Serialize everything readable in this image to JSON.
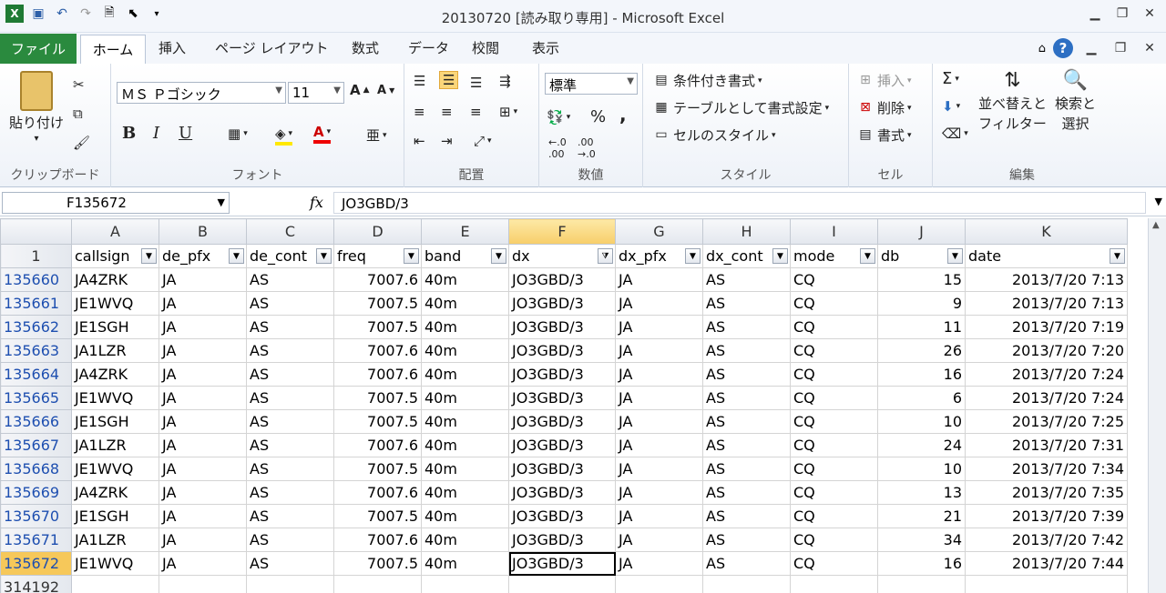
{
  "window": {
    "title": "20130720  [読み取り専用]  -  Microsoft Excel"
  },
  "tabs": [
    "ファイル",
    "ホーム",
    "挿入",
    "ページ レイアウト",
    "数式",
    "データ",
    "校閲",
    "表示"
  ],
  "ribbon": {
    "clipboard": {
      "paste": "貼り付け",
      "label": "クリップボード"
    },
    "font": {
      "name": "ＭＳ Ｐゴシック",
      "size": "11",
      "bold": "B",
      "italic": "I",
      "underline": "U",
      "label": "フォント"
    },
    "alignment": {
      "label": "配置"
    },
    "number": {
      "format": "標準",
      "percent": "%",
      "comma": ",",
      "label": "数値"
    },
    "styles": {
      "conditional": "条件付き書式",
      "table": "テーブルとして書式設定",
      "cell_styles": "セルのスタイル",
      "label": "スタイル"
    },
    "cells": {
      "insert": "挿入",
      "delete": "削除",
      "format": "書式",
      "label": "セル"
    },
    "editing": {
      "sigma": "Σ",
      "sort_filter": "並べ替えと\nフィルター",
      "find_select": "検索と\n選択",
      "label": "編集"
    }
  },
  "formula_bar": {
    "name_box": "F135672",
    "fx": "fx",
    "value": "JO3GBD/3"
  },
  "sheet": {
    "columns": [
      "A",
      "B",
      "C",
      "D",
      "E",
      "F",
      "G",
      "H",
      "I",
      "J",
      "K"
    ],
    "header_row_number": "1",
    "headers": [
      "callsign",
      "de_pfx",
      "de_cont",
      "freq",
      "band",
      "dx",
      "dx_pfx",
      "dx_cont",
      "mode",
      "db",
      "date"
    ],
    "rows": [
      {
        "n": "135660",
        "cells": [
          "JA4ZRK",
          "JA",
          "AS",
          "7007.6",
          "40m",
          "JO3GBD/3",
          "JA",
          "AS",
          "CQ",
          "15",
          "2013/7/20 7:13"
        ]
      },
      {
        "n": "135661",
        "cells": [
          "JE1WVQ",
          "JA",
          "AS",
          "7007.5",
          "40m",
          "JO3GBD/3",
          "JA",
          "AS",
          "CQ",
          "9",
          "2013/7/20 7:13"
        ]
      },
      {
        "n": "135662",
        "cells": [
          "JE1SGH",
          "JA",
          "AS",
          "7007.5",
          "40m",
          "JO3GBD/3",
          "JA",
          "AS",
          "CQ",
          "11",
          "2013/7/20 7:19"
        ]
      },
      {
        "n": "135663",
        "cells": [
          "JA1LZR",
          "JA",
          "AS",
          "7007.6",
          "40m",
          "JO3GBD/3",
          "JA",
          "AS",
          "CQ",
          "26",
          "2013/7/20 7:20"
        ]
      },
      {
        "n": "135664",
        "cells": [
          "JA4ZRK",
          "JA",
          "AS",
          "7007.6",
          "40m",
          "JO3GBD/3",
          "JA",
          "AS",
          "CQ",
          "16",
          "2013/7/20 7:24"
        ]
      },
      {
        "n": "135665",
        "cells": [
          "JE1WVQ",
          "JA",
          "AS",
          "7007.5",
          "40m",
          "JO3GBD/3",
          "JA",
          "AS",
          "CQ",
          "6",
          "2013/7/20 7:24"
        ]
      },
      {
        "n": "135666",
        "cells": [
          "JE1SGH",
          "JA",
          "AS",
          "7007.5",
          "40m",
          "JO3GBD/3",
          "JA",
          "AS",
          "CQ",
          "10",
          "2013/7/20 7:25"
        ]
      },
      {
        "n": "135667",
        "cells": [
          "JA1LZR",
          "JA",
          "AS",
          "7007.6",
          "40m",
          "JO3GBD/3",
          "JA",
          "AS",
          "CQ",
          "24",
          "2013/7/20 7:31"
        ]
      },
      {
        "n": "135668",
        "cells": [
          "JE1WVQ",
          "JA",
          "AS",
          "7007.5",
          "40m",
          "JO3GBD/3",
          "JA",
          "AS",
          "CQ",
          "10",
          "2013/7/20 7:34"
        ]
      },
      {
        "n": "135669",
        "cells": [
          "JA4ZRK",
          "JA",
          "AS",
          "7007.6",
          "40m",
          "JO3GBD/3",
          "JA",
          "AS",
          "CQ",
          "13",
          "2013/7/20 7:35"
        ]
      },
      {
        "n": "135670",
        "cells": [
          "JE1SGH",
          "JA",
          "AS",
          "7007.5",
          "40m",
          "JO3GBD/3",
          "JA",
          "AS",
          "CQ",
          "21",
          "2013/7/20 7:39"
        ]
      },
      {
        "n": "135671",
        "cells": [
          "JA1LZR",
          "JA",
          "AS",
          "7007.6",
          "40m",
          "JO3GBD/3",
          "JA",
          "AS",
          "CQ",
          "34",
          "2013/7/20 7:42"
        ]
      },
      {
        "n": "135672",
        "cells": [
          "JE1WVQ",
          "JA",
          "AS",
          "7007.5",
          "40m",
          "JO3GBD/3",
          "JA",
          "AS",
          "CQ",
          "16",
          "2013/7/20 7:44"
        ]
      }
    ],
    "trailing_row_number": "314192",
    "active_column": "F",
    "active_row": "135672"
  }
}
